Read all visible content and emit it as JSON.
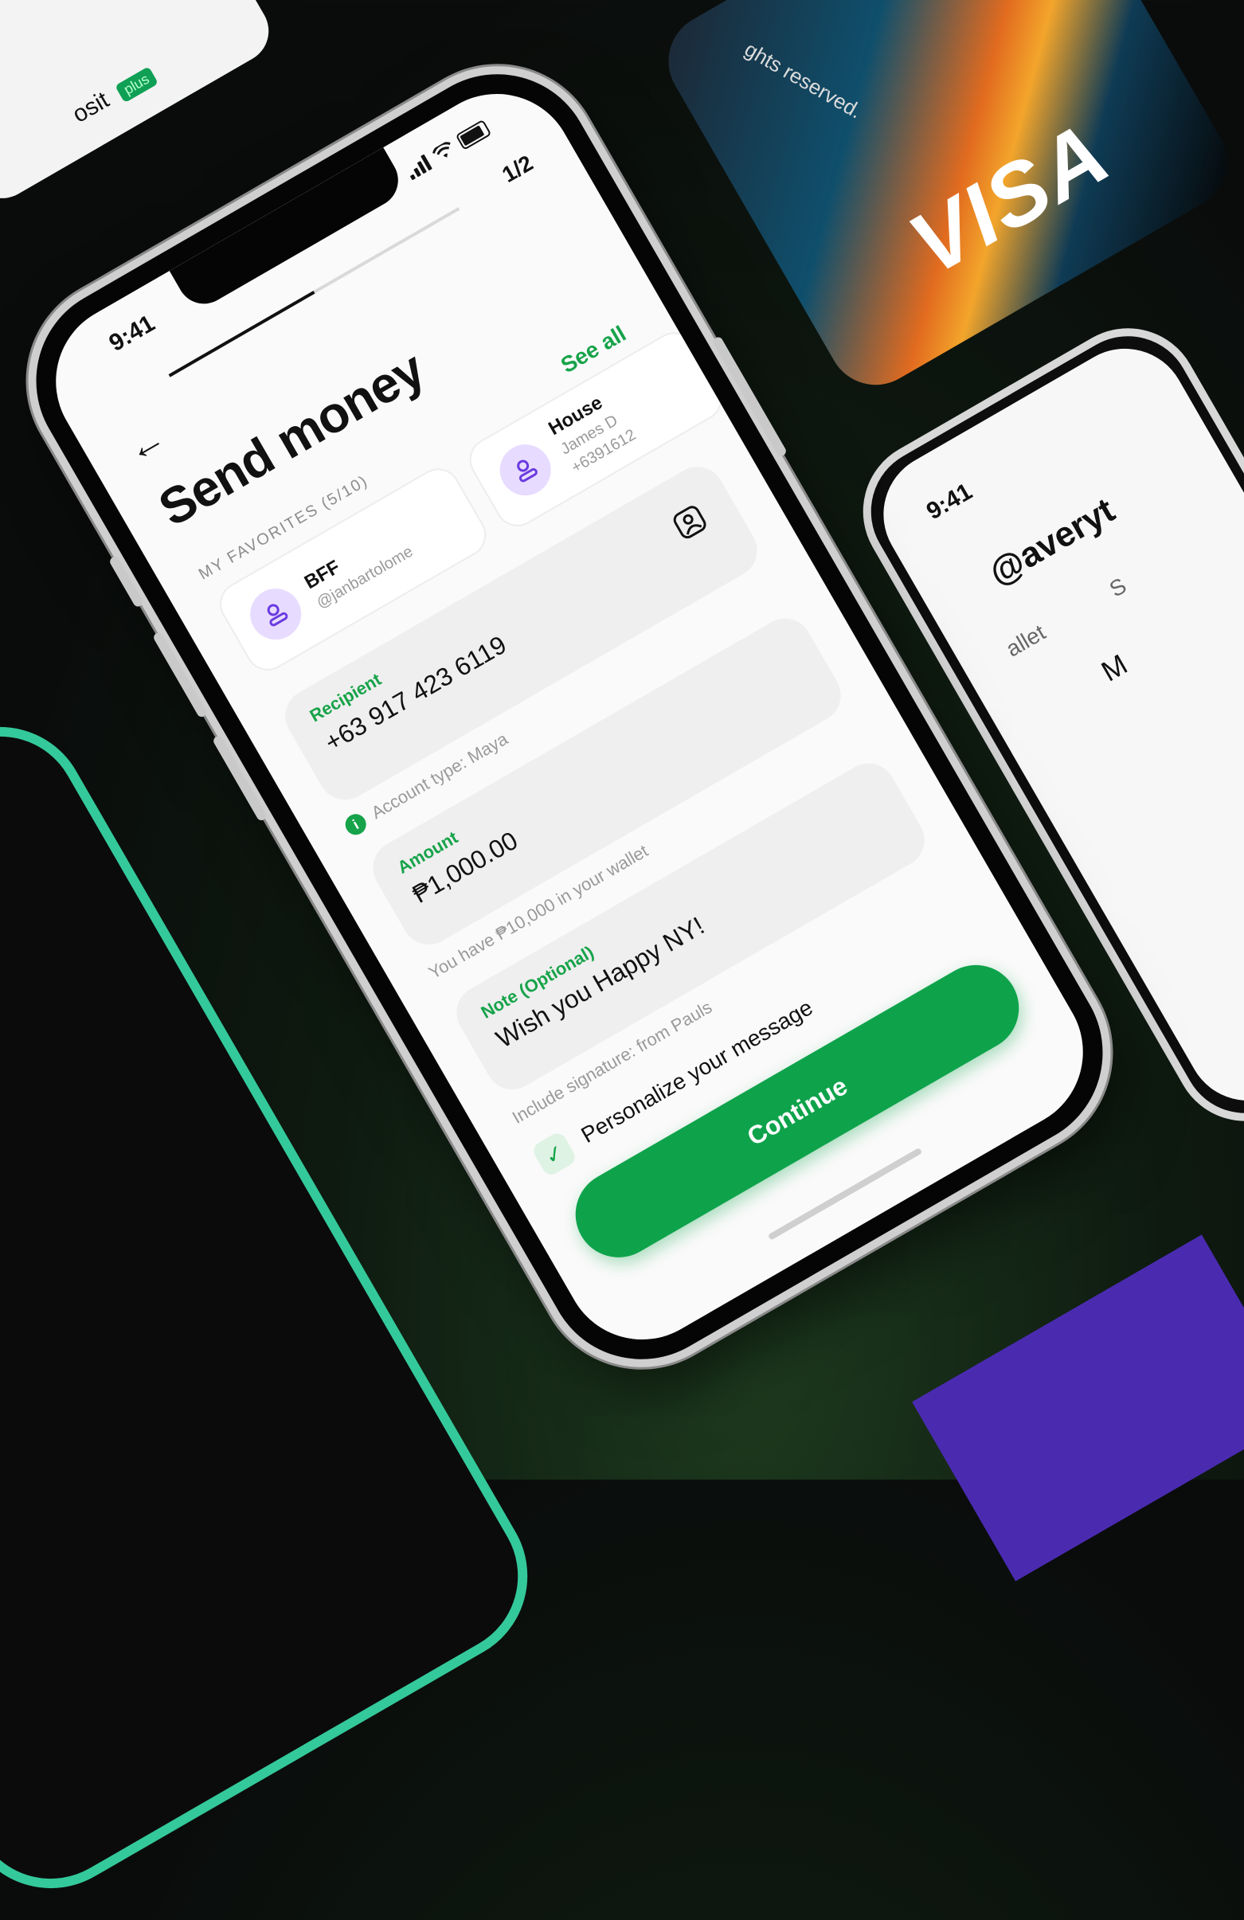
{
  "background": {
    "top_card_text": "osit",
    "top_card_badge": "plus",
    "visa_brand": "VISA",
    "visa_rights": "ghts reserved."
  },
  "right_phone": {
    "time": "9:41",
    "handle": "@averyt",
    "tab1": "allet",
    "tab2": "S",
    "label": "M"
  },
  "status_bar": {
    "time": "9:41"
  },
  "header": {
    "step": "1/2",
    "progress": 0.5,
    "title": "Send money"
  },
  "favorites": {
    "heading": "MY FAVORITES (5/10)",
    "see_all": "See all",
    "items": [
      {
        "name": "BFF",
        "sub": "@janbartolome"
      },
      {
        "name": "House",
        "sub": "James D",
        "sub2": "+6391612"
      }
    ]
  },
  "form": {
    "recipient": {
      "label": "Recipient",
      "value": "+63 917 423 6119",
      "helper": "Account type: Maya"
    },
    "amount": {
      "label": "Amount",
      "value": "₱1,000.00",
      "helper": "You have ₱10,000 in your wallet"
    },
    "note": {
      "label": "Note (Optional)",
      "value": "Wish you Happy NY!",
      "helper": "Include signature: from Pauls"
    },
    "personalize_label": "Personalize your message",
    "personalize_checked": true
  },
  "continue_label": "Continue",
  "colors": {
    "accent": "#0ea34b",
    "avatar_bg": "#e7dcff",
    "avatar_icon": "#6a3ae0"
  }
}
